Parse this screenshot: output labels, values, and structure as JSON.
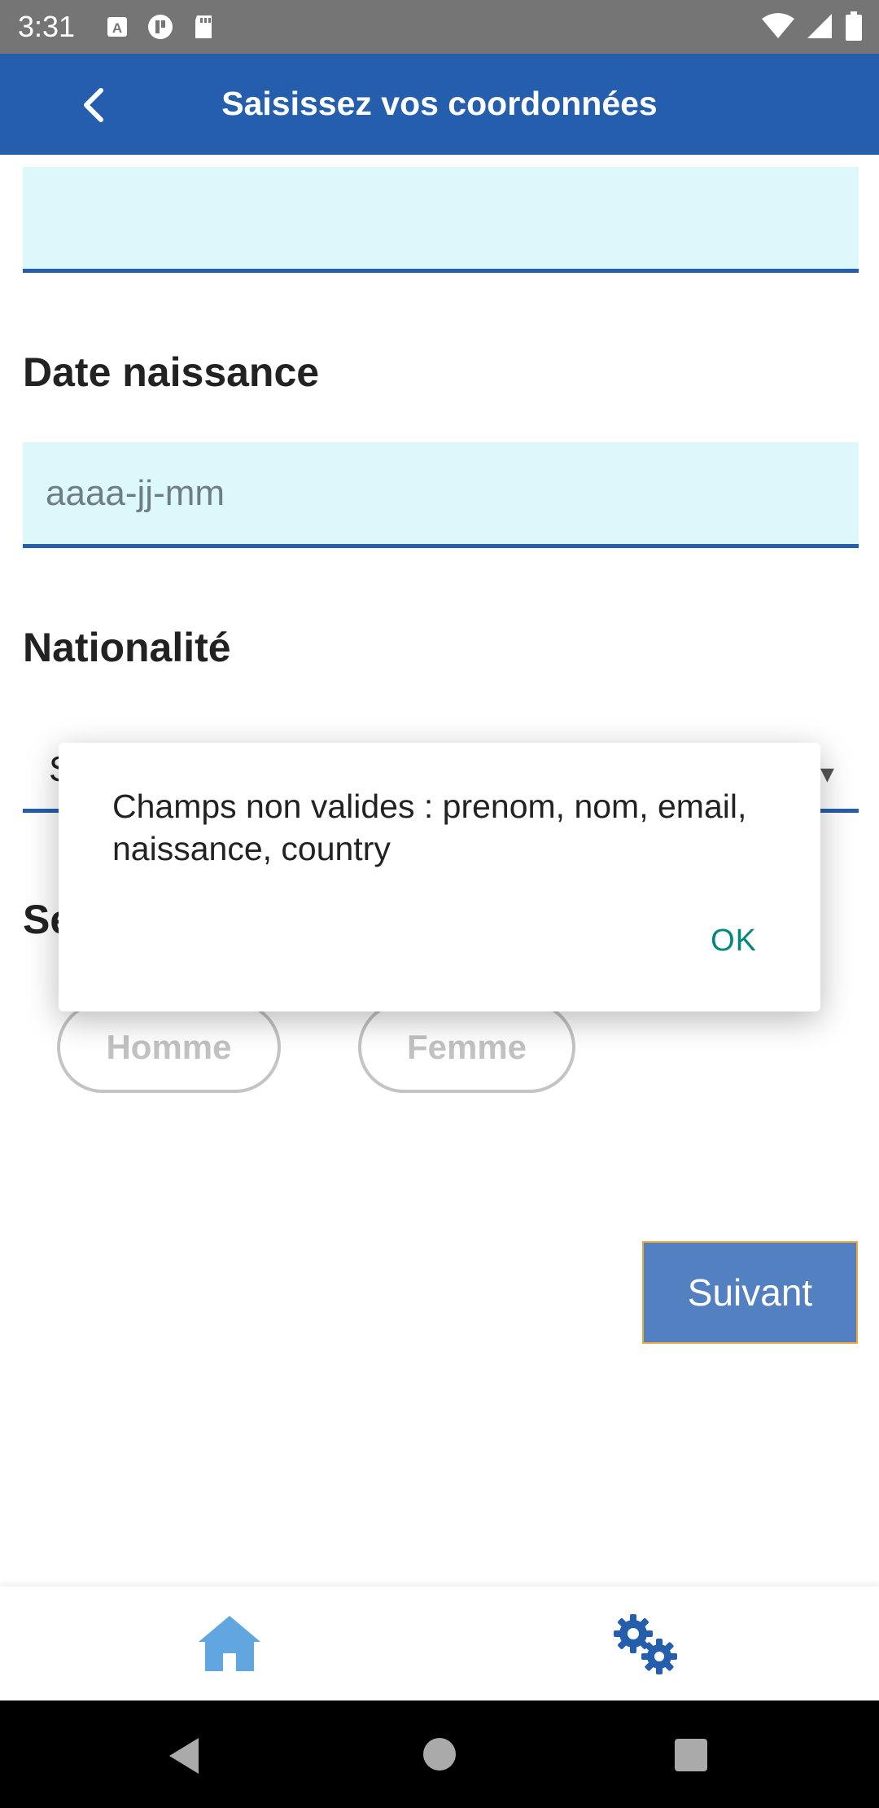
{
  "status_bar": {
    "time": "3:31"
  },
  "app_bar": {
    "title": "Saisissez vos coordonnées"
  },
  "form": {
    "field_top": {
      "value": ""
    },
    "date": {
      "label": "Date naissance",
      "placeholder": "aaaa-jj-mm"
    },
    "nationality": {
      "label": "Nationalité",
      "value_partial": "S"
    },
    "sexe": {
      "label_partial": "Se",
      "options": [
        "Homme",
        "Femme"
      ]
    },
    "next_label": "Suivant"
  },
  "dialog": {
    "message": "Champs non valides : prenom, nom, email, naissance, country",
    "ok_label": "OK"
  },
  "bottom_nav": {
    "home_icon": "home-icon",
    "settings_icon": "gears-icon"
  },
  "colors": {
    "primary": "#245ead",
    "field_bg": "#dcf8fb",
    "button": "#5380c1",
    "ok": "#00897b",
    "home_icon": "#62a6e0"
  }
}
